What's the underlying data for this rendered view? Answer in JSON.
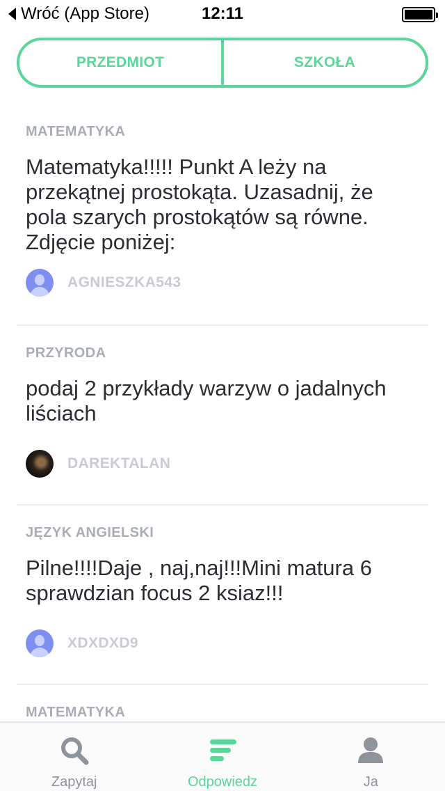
{
  "status_bar": {
    "back_label": "Wróć (App Store)",
    "time": "12:11"
  },
  "segmented": {
    "left_label": "PRZEDMIOT",
    "right_label": "SZKOŁA"
  },
  "feed": {
    "items": [
      {
        "subject": "MATEMATYKA",
        "question": "Matematyka!!!!!   Punkt A leży na przekątnej prostokąta. Uzasadnij, że pola szarych prostokątów są równe.   Zdjęcie poniżej:",
        "author": "AGNIESZKA543"
      },
      {
        "subject": "PRZYRODA",
        "question": "podaj 2 przykłady warzyw o jadalnych liściach",
        "author": "DAREKTALAN"
      },
      {
        "subject": "JĘZYK ANGIELSKI",
        "question": "Pilne!!!!Daje , naj,naj!!!Mini matura 6 sprawdzian focus 2 ksiaz!!!",
        "author": "XDXDXD9"
      },
      {
        "subject": "MATEMATYKA"
      }
    ]
  },
  "tabbar": {
    "tabs": [
      {
        "label": "Zapytaj",
        "icon": "search-icon"
      },
      {
        "label": "Odpowiedz",
        "icon": "answer-lines-icon",
        "active": true
      },
      {
        "label": "Ja",
        "icon": "user-icon"
      }
    ]
  },
  "colors": {
    "accent": "#5cd59b",
    "subject_gray": "#a9adb5",
    "avatar_blue": "#7e8ff0"
  }
}
